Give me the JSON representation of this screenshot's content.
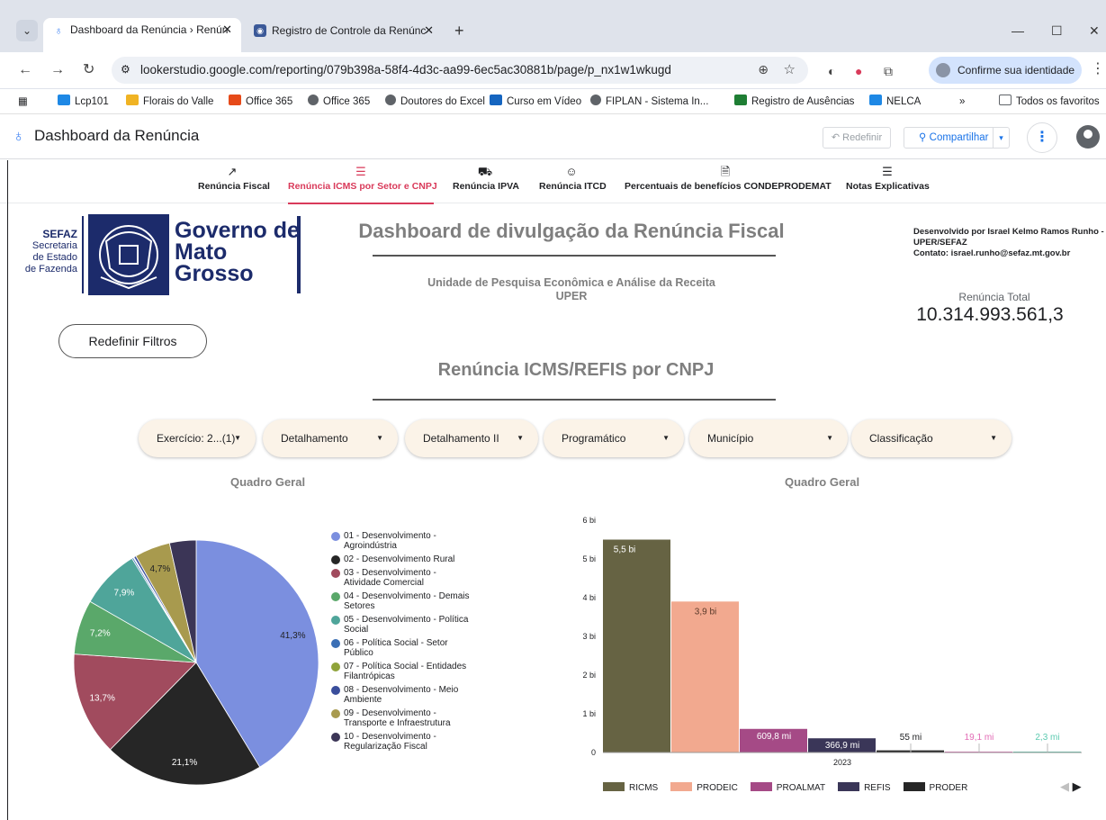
{
  "browser": {
    "tabs": [
      {
        "label": "Dashboard da Renúncia › Renún",
        "active": true
      },
      {
        "label": "Registro de Controle da Renúnc",
        "active": false
      }
    ],
    "url": "lookerstudio.google.com/reporting/079b398a-58f4-4d3c-aa99-6ec5ac30881b/page/p_nx1w1wkugd",
    "identity_label": "Confirme sua identidade",
    "bookmarks": [
      "Lcp101",
      "Florais do Valle",
      "Office 365",
      "Office 365",
      "Doutores do Excel",
      "Curso em Vídeo",
      "FIPLAN - Sistema In...",
      "Registro de Ausências",
      "NELCA",
      "Todos os favoritos"
    ]
  },
  "app": {
    "title": "Dashboard da Renúncia",
    "reset_label": "Redefinir",
    "share_label": "Compartilhar"
  },
  "pages": [
    {
      "label": "Renúncia Fiscal",
      "icon": "trend-icon"
    },
    {
      "label": "Renúncia ICMS por Setor e CNPJ",
      "icon": "list-icon",
      "active": true
    },
    {
      "label": "Renúncia IPVA",
      "icon": "truck-icon"
    },
    {
      "label": "Renúncia ITCD",
      "icon": "person-icon"
    },
    {
      "label": "Percentuais de benefícios CONDEPRODEMAT",
      "icon": "document-icon"
    },
    {
      "label": "Notas Explicativas",
      "icon": "list-icon"
    }
  ],
  "header": {
    "sefaz_line1": "SEFAZ",
    "sefaz_line2": "Secretaria",
    "sefaz_line3": "de Estado",
    "sefaz_line4": "de Fazenda",
    "gov_line1": "Governo de",
    "gov_line2": "Mato",
    "gov_line3": "Grosso",
    "main_title": "Dashboard de divulgação da Renúncia Fiscal",
    "subtitle_line1": "Unidade de Pesquisa Econômica e Análise da Receita",
    "subtitle_line2": "UPER",
    "dev_line1": "Desenvolvido por Israel Kelmo Ramos Runho -",
    "dev_line2": "UPER/SEFAZ",
    "dev_line3": "Contato: israel.runho@sefaz.mt.gov.br",
    "total_label": "Renúncia Total",
    "total_value": "10.314.993.561,3"
  },
  "reset_filters_label": "Redefinir Filtros",
  "section_title": "Renúncia ICMS/REFIS por CNPJ",
  "filters": [
    "Exercício: 2...(1)",
    "Detalhamento",
    "Detalhamento II",
    "Programático",
    "Município",
    "Classificação"
  ],
  "colors": {
    "accent": "#d93a5a",
    "brand_navy": "#1c2b6b"
  },
  "chart_data": [
    {
      "type": "pie",
      "title": "Quadro Geral",
      "categories": [
        "01 - Desenvolvimento - Agroindústria",
        "02 - Desenvolvimento Rural",
        "03 - Desenvolvimento - Atividade Comercial",
        "04 - Desenvolvimento - Demais Setores",
        "05 - Desenvolvimento - Política Social",
        "06 - Política Social - Setor Público",
        "07 - Política Social - Entidades Filantrópicas",
        "08 - Desenvolvimento - Meio Ambiente",
        "09 - Desenvolvimento - Transporte e Infraestrutura",
        "10 - Desenvolvimento - Regularização Fiscal"
      ],
      "values": [
        41.3,
        21.1,
        13.7,
        7.2,
        7.9,
        0.2,
        0.1,
        0.3,
        4.7,
        3.5
      ],
      "labels": [
        "41,3%",
        "21,1%",
        "13,7%",
        "7,2%",
        "7,9%",
        "",
        "",
        "",
        "4,7%",
        ""
      ],
      "colors": [
        "#7b8fdf",
        "#262626",
        "#a14b5e",
        "#5aa86a",
        "#4fa59a",
        "#3b6fb5",
        "#8fa33a",
        "#3a4e9c",
        "#a89a4e",
        "#3b3556"
      ],
      "legend": "right"
    },
    {
      "type": "bar",
      "title": "Quadro Geral",
      "x": [
        "2023"
      ],
      "series": [
        {
          "name": "RICMS",
          "values": [
            5.5
          ],
          "label": "5,5 bi",
          "color": "#666343"
        },
        {
          "name": "PRODEIC",
          "values": [
            3.9
          ],
          "label": "3,9 bi",
          "color": "#f2a98f"
        },
        {
          "name": "PROALMAT",
          "values": [
            0.6098
          ],
          "label": "609,8 mi",
          "color": "#a54a86"
        },
        {
          "name": "REFIS",
          "values": [
            0.3669
          ],
          "label": "366,9 mi",
          "color": "#3a3658"
        },
        {
          "name": "PRODER",
          "values": [
            0.055
          ],
          "label": "55 mi",
          "color": "#262626"
        },
        {
          "name": "",
          "values": [
            0.0191
          ],
          "label": "19,1 mi",
          "color": "#e26bb5"
        },
        {
          "name": "",
          "values": [
            0.0023
          ],
          "label": "2,3 mi",
          "color": "#5ccab0"
        }
      ],
      "ylim": [
        0,
        6
      ],
      "yticks": [
        "0",
        "1 bi",
        "2 bi",
        "3 bi",
        "4 bi",
        "5 bi",
        "6 bi"
      ],
      "legend": "bottom",
      "legend_pager": [
        "◀",
        "▶"
      ]
    }
  ]
}
